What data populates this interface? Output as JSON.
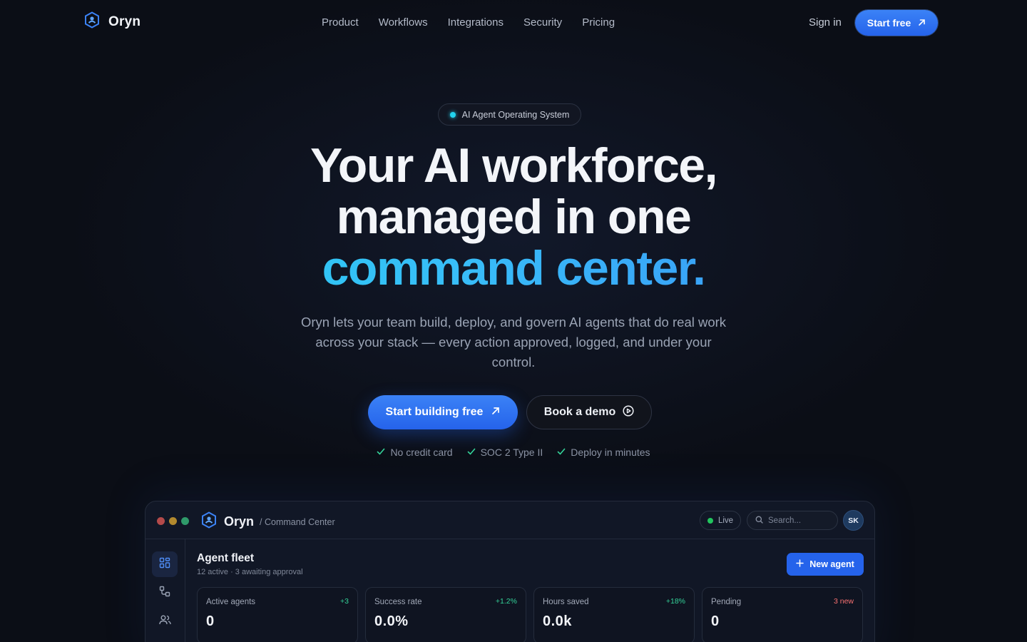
{
  "colors": {
    "background": "#0b0e16",
    "accent": "#2563eb",
    "gradient_start": "#22d3ee",
    "gradient_end": "#3b82f6",
    "positive": "#34d399",
    "warning": "#f87171"
  },
  "nav": {
    "brand": "Oryn",
    "links": [
      "Product",
      "Workflows",
      "Integrations",
      "Security",
      "Pricing"
    ],
    "signin": "Sign in",
    "start_free": "Start free"
  },
  "hero": {
    "badge": "AI Agent Operating System",
    "headline_line1": "Your AI workforce,",
    "headline_line2": "managed in one",
    "headline_line3": "command center.",
    "subtext": "Oryn lets your team build, deploy, and govern AI agents that do real work across your stack — every action approved, logged, and under your control.",
    "cta_primary": "Start building free",
    "cta_secondary": "Book a demo",
    "checks": [
      "No credit card",
      "SOC 2 Type II",
      "Deploy in minutes"
    ]
  },
  "app": {
    "brand": "Oryn",
    "breadcrumb": "/ Command Center",
    "live": "Live",
    "search_placeholder": "Search...",
    "avatar": "SK",
    "title": "Agent fleet",
    "subtitle": "12 active · 3 awaiting approval",
    "new_agent": "New agent",
    "stats": [
      {
        "label": "Active agents",
        "delta": "+3",
        "value": "0"
      },
      {
        "label": "Success rate",
        "delta": "+1.2%",
        "value": "0.0%"
      },
      {
        "label": "Hours saved",
        "delta": "+18%",
        "value": "0.0k"
      },
      {
        "label": "Pending",
        "delta": "3 new",
        "value": "0"
      }
    ]
  }
}
